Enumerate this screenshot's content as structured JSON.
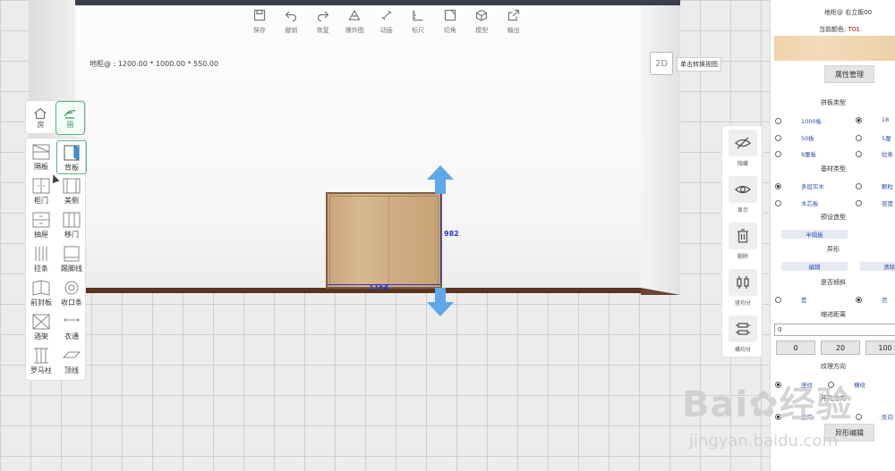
{
  "toolbar": {
    "items": [
      {
        "icon": "save-icon",
        "label": "保存"
      },
      {
        "icon": "undo-icon",
        "label": "撤销"
      },
      {
        "icon": "redo-icon",
        "label": "恢复"
      },
      {
        "icon": "explode-icon",
        "label": "爆炸图"
      },
      {
        "icon": "animation-icon",
        "label": "动画"
      },
      {
        "icon": "ruler-icon",
        "label": "标尺"
      },
      {
        "icon": "crop-icon",
        "label": "切角"
      },
      {
        "icon": "cube-icon",
        "label": "模型"
      },
      {
        "icon": "export-icon",
        "label": "输出"
      }
    ]
  },
  "canvas": {
    "dimensions_text": "地柜@ : 1200.00 * 1000.00 * 550.00",
    "btn_2d": "2D",
    "tip_2d": "单击转换视图",
    "width_label": "1164",
    "height_label": "982"
  },
  "left_panel": {
    "modes": [
      {
        "icon": "house-icon",
        "label": "房"
      },
      {
        "icon": "paint-icon",
        "label": "画"
      }
    ],
    "items": [
      {
        "icon": "partition-icon",
        "label": "隔板"
      },
      {
        "icon": "backboard-icon",
        "label": "背板"
      },
      {
        "icon": "cabinet-door-icon",
        "label": "柜门"
      },
      {
        "icon": "side-panel-icon",
        "label": "美侧"
      },
      {
        "icon": "drawer-icon",
        "label": "抽屉"
      },
      {
        "icon": "sliding-door-icon",
        "label": "移门"
      },
      {
        "icon": "strip-icon",
        "label": "拉条"
      },
      {
        "icon": "kickboard-icon",
        "label": "踢脚线"
      },
      {
        "icon": "front-seal-icon",
        "label": "前封板"
      },
      {
        "icon": "edge-strip-icon",
        "label": "收口条"
      },
      {
        "icon": "wine-rack-icon",
        "label": "酒架"
      },
      {
        "icon": "hanger-rod-icon",
        "label": "衣通"
      },
      {
        "icon": "roman-pillar-icon",
        "label": "罗马柱"
      },
      {
        "icon": "top-line-icon",
        "label": "顶线"
      }
    ]
  },
  "side_tools": [
    {
      "icon": "hide-icon",
      "label": "隐藏"
    },
    {
      "icon": "show-icon",
      "label": "显示"
    },
    {
      "icon": "delete-icon",
      "label": "删除"
    },
    {
      "icon": "vertical-split-icon",
      "label": "竖均分"
    },
    {
      "icon": "horizontal-split-icon",
      "label": "横均分"
    }
  ],
  "props": {
    "title": "地柜@ 右立板00",
    "color_label": "当前颜色:",
    "color_code": "T01",
    "attr_button": "属性管理",
    "panel_type": {
      "title": "拼板类型",
      "options": [
        "1000板",
        "18",
        "50板",
        "5厘",
        "9厘板",
        "拉条"
      ]
    },
    "material": {
      "title": "基材类型",
      "options": [
        "多层实木",
        "颗粒",
        "木芯板",
        "密度"
      ]
    },
    "preset": {
      "title": "预设造型",
      "button": "半隔板"
    },
    "shape": {
      "title": "异形",
      "edit": "编辑",
      "clear": "清除"
    },
    "tilt": {
      "title": "是否倾斜",
      "yes": "是",
      "no": "否"
    },
    "indent": {
      "title": "缩进距离",
      "value": "0",
      "options": [
        "0",
        "20",
        "100"
      ]
    },
    "grain": {
      "title": "纹理方向",
      "vertical": "竖纹",
      "horizontal": "横纹"
    },
    "hole": {
      "title": "开孔方向",
      "front": "正向",
      "back": "反向"
    },
    "shape_edit_button": "异形编辑"
  },
  "watermark": {
    "main": "Bai✿经验",
    "sub": "jingyan.baidu.com"
  },
  "colors": {
    "accent_green": "#5bb37f",
    "arrow_blue": "#5ea7e8",
    "dim_blue": "#2a36c9",
    "highlight_red": "#cc0000"
  }
}
